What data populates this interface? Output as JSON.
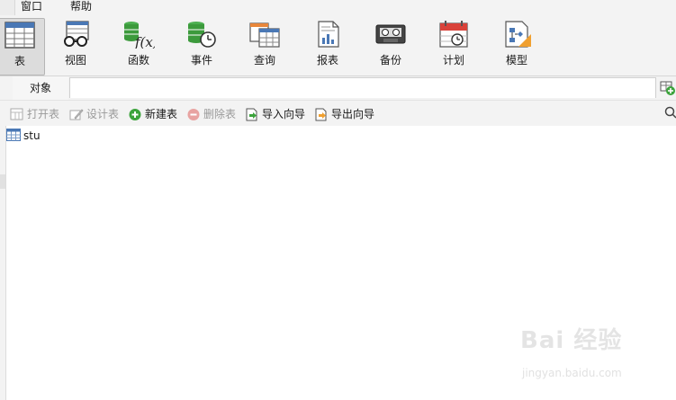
{
  "menubar": {
    "items": [
      "窗口",
      "帮助"
    ]
  },
  "toolbar": {
    "buttons": [
      {
        "label": "表",
        "icon": "table-icon",
        "active": true
      },
      {
        "label": "视图",
        "icon": "view-glasses-icon"
      },
      {
        "label": "函数",
        "icon": "function-icon"
      },
      {
        "label": "事件",
        "icon": "event-clock-icon"
      },
      {
        "label": "查询",
        "icon": "query-table-icon"
      },
      {
        "label": "报表",
        "icon": "report-chart-icon"
      },
      {
        "label": "备份",
        "icon": "backup-tape-icon"
      },
      {
        "label": "计划",
        "icon": "schedule-calendar-icon"
      },
      {
        "label": "模型",
        "icon": "model-diagram-icon"
      }
    ]
  },
  "tabs": {
    "objects_label": "对象"
  },
  "actions": {
    "open_table": "打开表",
    "design_table": "设计表",
    "new_table": "新建表",
    "delete_table": "删除表",
    "import_wizard": "导入向导",
    "export_wizard": "导出向导"
  },
  "objects": {
    "tables": [
      "stu"
    ]
  },
  "watermark": {
    "text": "Bai 经验",
    "url": "jingyan.baidu.com"
  },
  "colors": {
    "accent_green": "#3ca33c",
    "delete_red": "#d9534f",
    "table_blue": "#4a78b5",
    "calendar_red": "#d9423a",
    "model_orange": "#f0a030"
  }
}
